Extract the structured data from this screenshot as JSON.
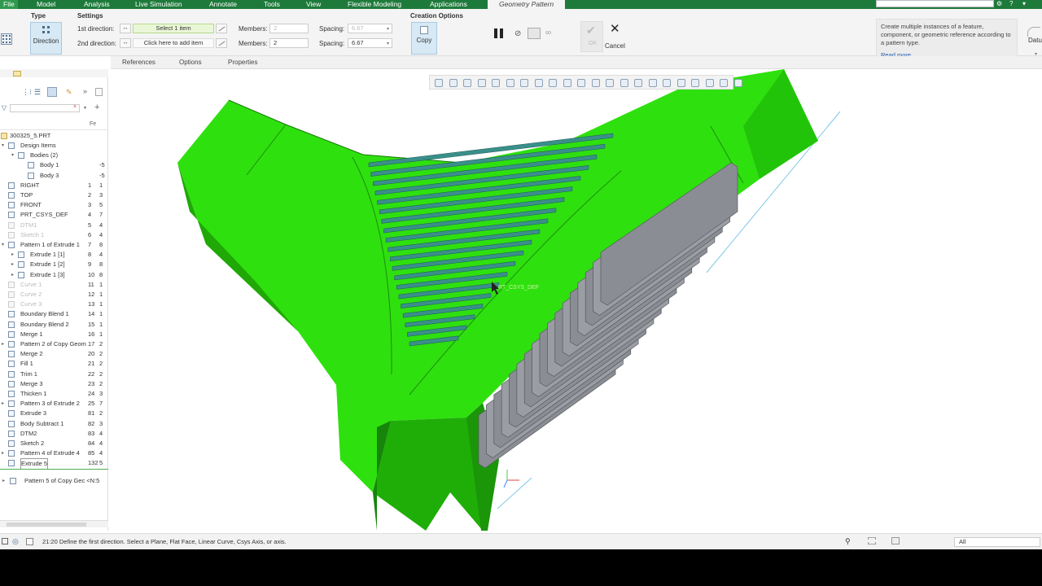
{
  "menu": {
    "tabs": [
      "File",
      "Model",
      "Analysis",
      "Live Simulation",
      "Annotate",
      "Tools",
      "View",
      "Flexible Modeling",
      "Applications"
    ],
    "active_tab": "Geometry Pattern"
  },
  "ribbon": {
    "type_label": "Type",
    "type_button": "Direction",
    "settings_label": "Settings",
    "first_direction_label": "1st direction:",
    "first_direction_value": "Select 1 item",
    "second_direction_label": "2nd direction:",
    "second_direction_value": "Click here to add item",
    "members_label": "Members:",
    "members_1": "2",
    "members_2": "2",
    "spacing_label": "Spacing:",
    "spacing_1": "6.67",
    "spacing_2": "6.67",
    "creation_options_label": "Creation Options",
    "copy_button": "Copy",
    "ok_label": "OK",
    "cancel_label": "Cancel",
    "datum_label": "Datu"
  },
  "help": {
    "text": "Create multiple instances of a feature, component, or geometric reference according to a pattern type.",
    "link": "Read more..."
  },
  "subtabs": [
    "References",
    "Options",
    "Properties"
  ],
  "tree": {
    "header_col": "Fe",
    "root": "300325_5.PRT",
    "rows": [
      {
        "label": "Design Items",
        "n1": "",
        "n2": "",
        "indent": 1,
        "caret": "▾",
        "dim": false
      },
      {
        "label": "Bodies (2)",
        "n1": "",
        "n2": "",
        "indent": 2,
        "caret": "▾",
        "dim": false
      },
      {
        "label": "Body 1",
        "n1": "",
        "n2": "-5",
        "indent": 3,
        "caret": "",
        "dim": false
      },
      {
        "label": "Body 3",
        "n1": "",
        "n2": "-5",
        "indent": 3,
        "caret": "",
        "dim": false
      },
      {
        "label": "RIGHT",
        "n1": "1",
        "n2": "1",
        "indent": 1,
        "caret": "",
        "dim": false
      },
      {
        "label": "TOP",
        "n1": "2",
        "n2": "3",
        "indent": 1,
        "caret": "",
        "dim": false
      },
      {
        "label": "FRONT",
        "n1": "3",
        "n2": "5",
        "indent": 1,
        "caret": "",
        "dim": false
      },
      {
        "label": "PRT_CSYS_DEF",
        "n1": "4",
        "n2": "7",
        "indent": 1,
        "caret": "",
        "dim": false
      },
      {
        "label": "DTM1",
        "n1": "5",
        "n2": "4",
        "indent": 1,
        "caret": "",
        "dim": true
      },
      {
        "label": "Sketch 1",
        "n1": "6",
        "n2": "4",
        "indent": 1,
        "caret": "",
        "dim": true
      },
      {
        "label": "Pattern 1 of Extrude 1",
        "n1": "7",
        "n2": "8",
        "indent": 1,
        "caret": "▾",
        "dim": false
      },
      {
        "label": "Extrude 1 [1]",
        "n1": "8",
        "n2": "4",
        "indent": 2,
        "caret": "▸",
        "dim": false
      },
      {
        "label": "Extrude 1 [2]",
        "n1": "9",
        "n2": "8",
        "indent": 2,
        "caret": "▸",
        "dim": false
      },
      {
        "label": "Extrude 1 [3]",
        "n1": "10",
        "n2": "8",
        "indent": 2,
        "caret": "▸",
        "dim": false
      },
      {
        "label": "Curve 1",
        "n1": "11",
        "n2": "1",
        "indent": 1,
        "caret": "",
        "dim": true
      },
      {
        "label": "Curve 2",
        "n1": "12",
        "n2": "1",
        "indent": 1,
        "caret": "",
        "dim": true
      },
      {
        "label": "Curve 3",
        "n1": "13",
        "n2": "1",
        "indent": 1,
        "caret": "",
        "dim": true
      },
      {
        "label": "Boundary Blend 1",
        "n1": "14",
        "n2": "1",
        "indent": 1,
        "caret": "",
        "dim": false
      },
      {
        "label": "Boundary Blend 2",
        "n1": "15",
        "n2": "1",
        "indent": 1,
        "caret": "",
        "dim": false
      },
      {
        "label": "Merge 1",
        "n1": "16",
        "n2": "1",
        "indent": 1,
        "caret": "",
        "dim": false
      },
      {
        "label": "Pattern 2 of Copy Geom",
        "n1": "17",
        "n2": "2",
        "indent": 1,
        "caret": "▸",
        "dim": false
      },
      {
        "label": "Merge 2",
        "n1": "20",
        "n2": "2",
        "indent": 1,
        "caret": "",
        "dim": false
      },
      {
        "label": "Fill 1",
        "n1": "21",
        "n2": "2",
        "indent": 1,
        "caret": "",
        "dim": false
      },
      {
        "label": "Trim 1",
        "n1": "22",
        "n2": "2",
        "indent": 1,
        "caret": "",
        "dim": false
      },
      {
        "label": "Merge 3",
        "n1": "23",
        "n2": "2",
        "indent": 1,
        "caret": "",
        "dim": false
      },
      {
        "label": "Thicken 1",
        "n1": "24",
        "n2": "3",
        "indent": 1,
        "caret": "",
        "dim": false
      },
      {
        "label": "Pattern 3 of Extrude 2",
        "n1": "25",
        "n2": "7",
        "indent": 1,
        "caret": "▸",
        "dim": false
      },
      {
        "label": "Extrude 3",
        "n1": "81",
        "n2": "2",
        "indent": 1,
        "caret": "",
        "dim": false
      },
      {
        "label": "Body Subtract 1",
        "n1": "82",
        "n2": "3",
        "indent": 1,
        "caret": "",
        "dim": false
      },
      {
        "label": "DTM2",
        "n1": "83",
        "n2": "4",
        "indent": 1,
        "caret": "",
        "dim": false
      },
      {
        "label": "Sketch 2",
        "n1": "84",
        "n2": "4",
        "indent": 1,
        "caret": "",
        "dim": false
      },
      {
        "label": "Pattern 4 of Extrude 4",
        "n1": "85",
        "n2": "4",
        "indent": 1,
        "caret": "▸",
        "dim": false
      },
      {
        "label": "Extrude 5",
        "n1": "132",
        "n2": "5",
        "indent": 1,
        "caret": "",
        "dim": false
      }
    ],
    "insert_row": "Pattern 5 of Copy Gec <N:5"
  },
  "status": {
    "message": "21:20 Define the first direction. Select a Plane, Flat Face, Linear Curve, Csys Axis, or axis.",
    "filter": "All"
  },
  "colors": {
    "menubar": "#1e7a3b",
    "part_green": "#33ee11",
    "fin_gray": "#8a8d93"
  }
}
